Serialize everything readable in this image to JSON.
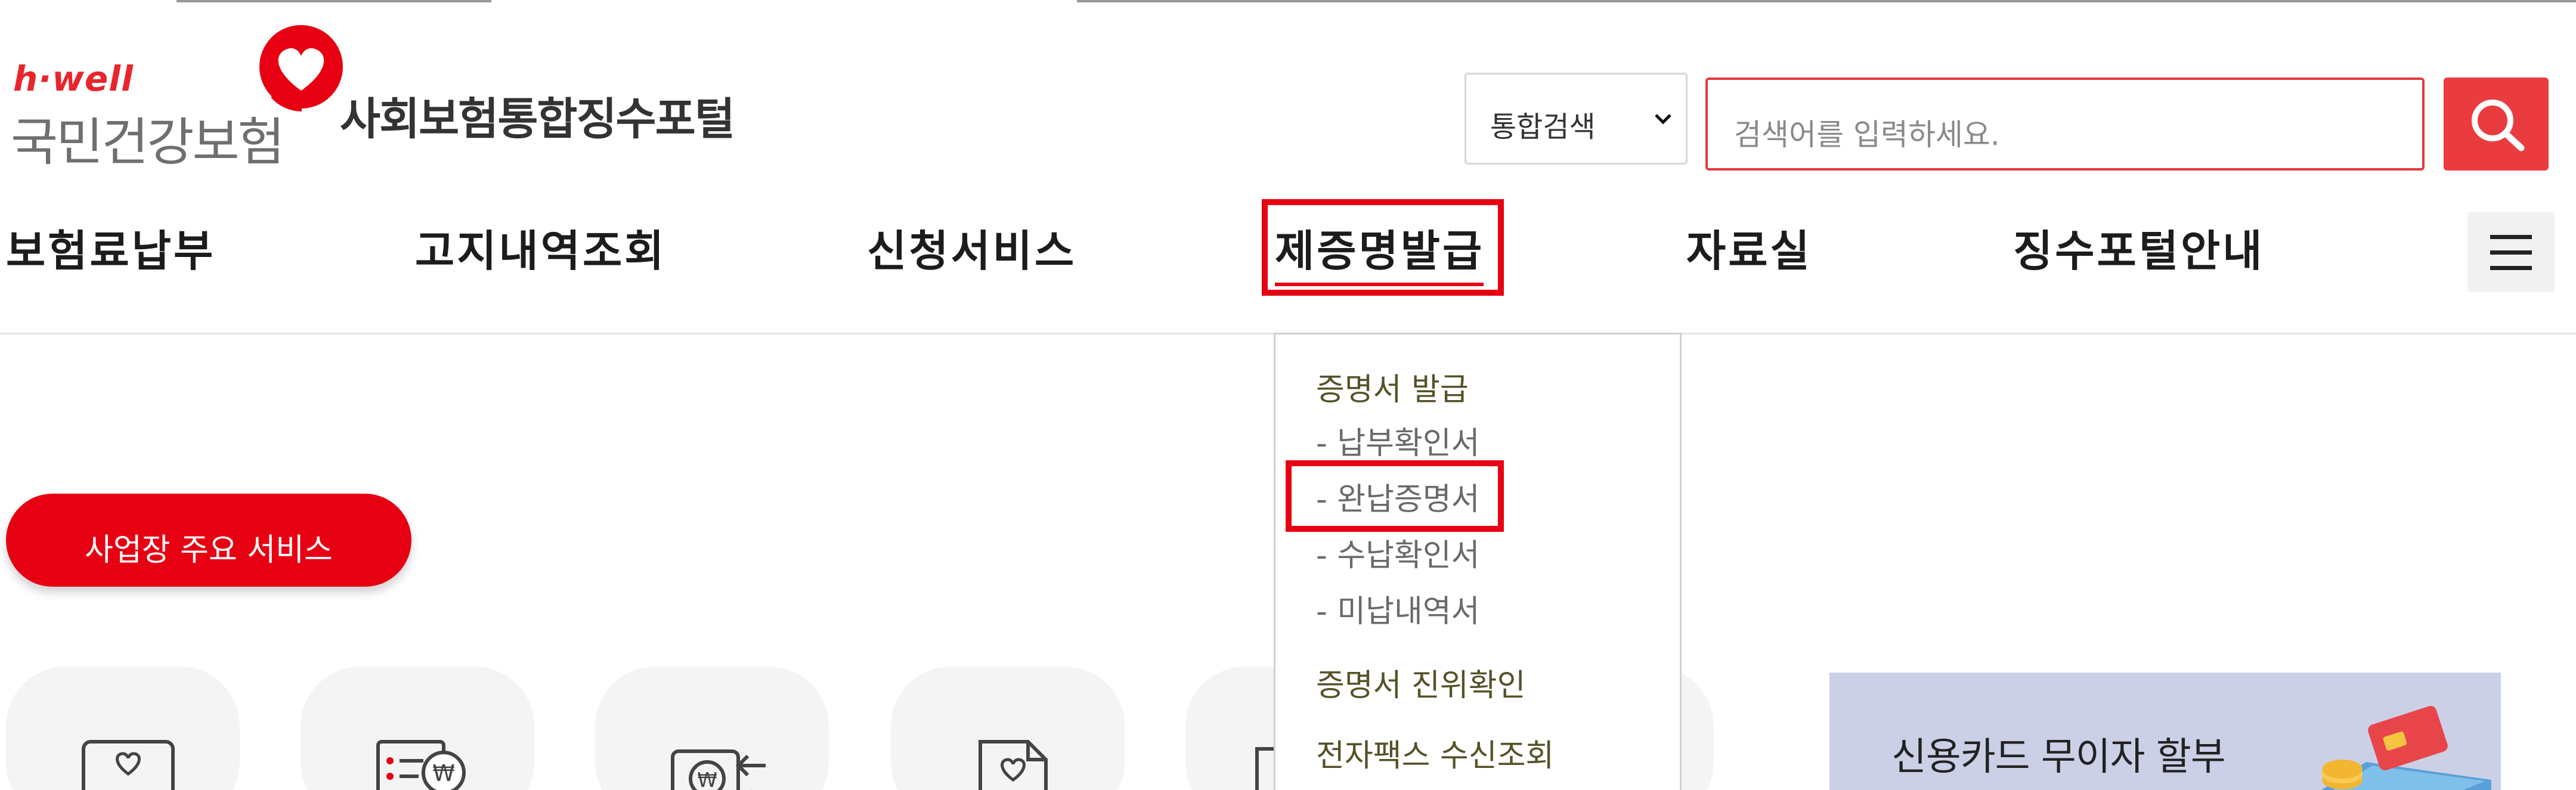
{
  "logo": {
    "brand": "h·well",
    "name": "국민건강보험"
  },
  "header": {
    "portal_title": "사회보험통합징수포털"
  },
  "search": {
    "scope_selected": "통합검색",
    "placeholder": "검색어를 입력하세요."
  },
  "gnb": {
    "items": [
      {
        "label": "보험료납부"
      },
      {
        "label": "고지내역조회"
      },
      {
        "label": "신청서비스"
      },
      {
        "label": "제증명발급"
      },
      {
        "label": "자료실"
      },
      {
        "label": "징수포털안내"
      }
    ],
    "active": "제증명발급"
  },
  "dropdown": {
    "groups": [
      {
        "label": "증명서 발급",
        "items": [
          "- 납부확인서",
          "- 완납증명서",
          "- 수납확인서",
          "- 미납내역서"
        ]
      },
      {
        "label": "증명서 진위확인",
        "items": []
      },
      {
        "label": "전자팩스 수신조회",
        "items": []
      }
    ],
    "highlighted": "- 완납증명서"
  },
  "main": {
    "service_button": "사업장 주요 서비스",
    "banner_title": "신용카드 무이자 할부"
  },
  "colors": {
    "accent": "#e60012",
    "search_button": "#ea3b3f",
    "banner_bg": "#ccd0e6",
    "dropdown_heading": "#555228"
  },
  "icons": [
    "heart-icon",
    "search-icon",
    "chevron-down-icon",
    "hamburger-menu-icon"
  ]
}
